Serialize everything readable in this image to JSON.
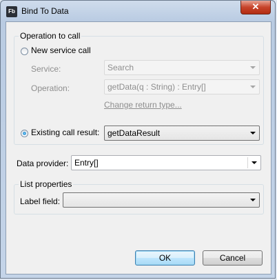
{
  "window": {
    "title": "Bind To Data",
    "app_icon_text": "Fb",
    "close_glyph": "✕"
  },
  "operation_group": {
    "legend": "Operation to call",
    "new_service_call": {
      "label": "New service call",
      "checked": false
    },
    "service": {
      "label": "Service:",
      "value": "Search"
    },
    "operation": {
      "label": "Operation:",
      "value": "getData(q : String) : Entry[]"
    },
    "change_return_type": "Change return type...",
    "existing_call_result": {
      "label": "Existing call result:",
      "value": "getDataResult",
      "checked": true
    }
  },
  "data_provider": {
    "label": "Data provider:",
    "value": "Entry[]"
  },
  "list_properties": {
    "legend": "List properties",
    "label_field": {
      "label": "Label field:",
      "value": ""
    }
  },
  "buttons": {
    "ok": "OK",
    "cancel": "Cancel"
  }
}
